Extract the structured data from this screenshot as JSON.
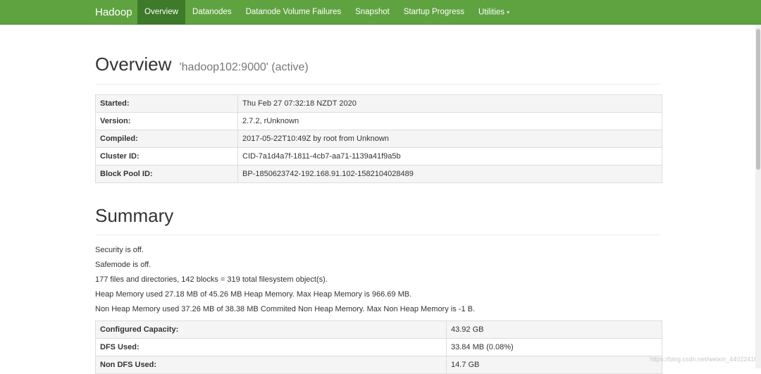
{
  "navbar": {
    "brand": "Hadoop",
    "items": [
      {
        "label": "Overview"
      },
      {
        "label": "Datanodes"
      },
      {
        "label": "Datanode Volume Failures"
      },
      {
        "label": "Snapshot"
      },
      {
        "label": "Startup Progress"
      },
      {
        "label": "Utilities"
      }
    ],
    "caret": "▾"
  },
  "overview": {
    "title": "Overview",
    "subtitle": "'hadoop102:9000' (active)",
    "rows": [
      {
        "key": "Started:",
        "value": "Thu Feb 27 07:32:18 NZDT 2020"
      },
      {
        "key": "Version:",
        "value": "2.7.2, rUnknown"
      },
      {
        "key": "Compiled:",
        "value": "2017-05-22T10:49Z by root from Unknown"
      },
      {
        "key": "Cluster ID:",
        "value": "CID-7a1d4a7f-1811-4cb7-aa71-1139a41f9a5b"
      },
      {
        "key": "Block Pool ID:",
        "value": "BP-1850623742-192.168.91.102-1582104028489"
      }
    ]
  },
  "summary": {
    "title": "Summary",
    "lines": [
      "Security is off.",
      "Safemode is off.",
      "177 files and directories, 142 blocks = 319 total filesystem object(s).",
      "Heap Memory used 27.18 MB of 45.26 MB Heap Memory. Max Heap Memory is 966.69 MB.",
      "Non Heap Memory used 37.26 MB of 38.38 MB Commited Non Heap Memory. Max Non Heap Memory is -1 B."
    ],
    "rows": [
      {
        "key": "Configured Capacity:",
        "value": "43.92 GB"
      },
      {
        "key": "DFS Used:",
        "value": "33.84 MB (0.08%)"
      },
      {
        "key": "Non DFS Used:",
        "value": "14.7 GB"
      }
    ]
  },
  "watermark": "https://blog.csdn.net/weixin_44022416"
}
